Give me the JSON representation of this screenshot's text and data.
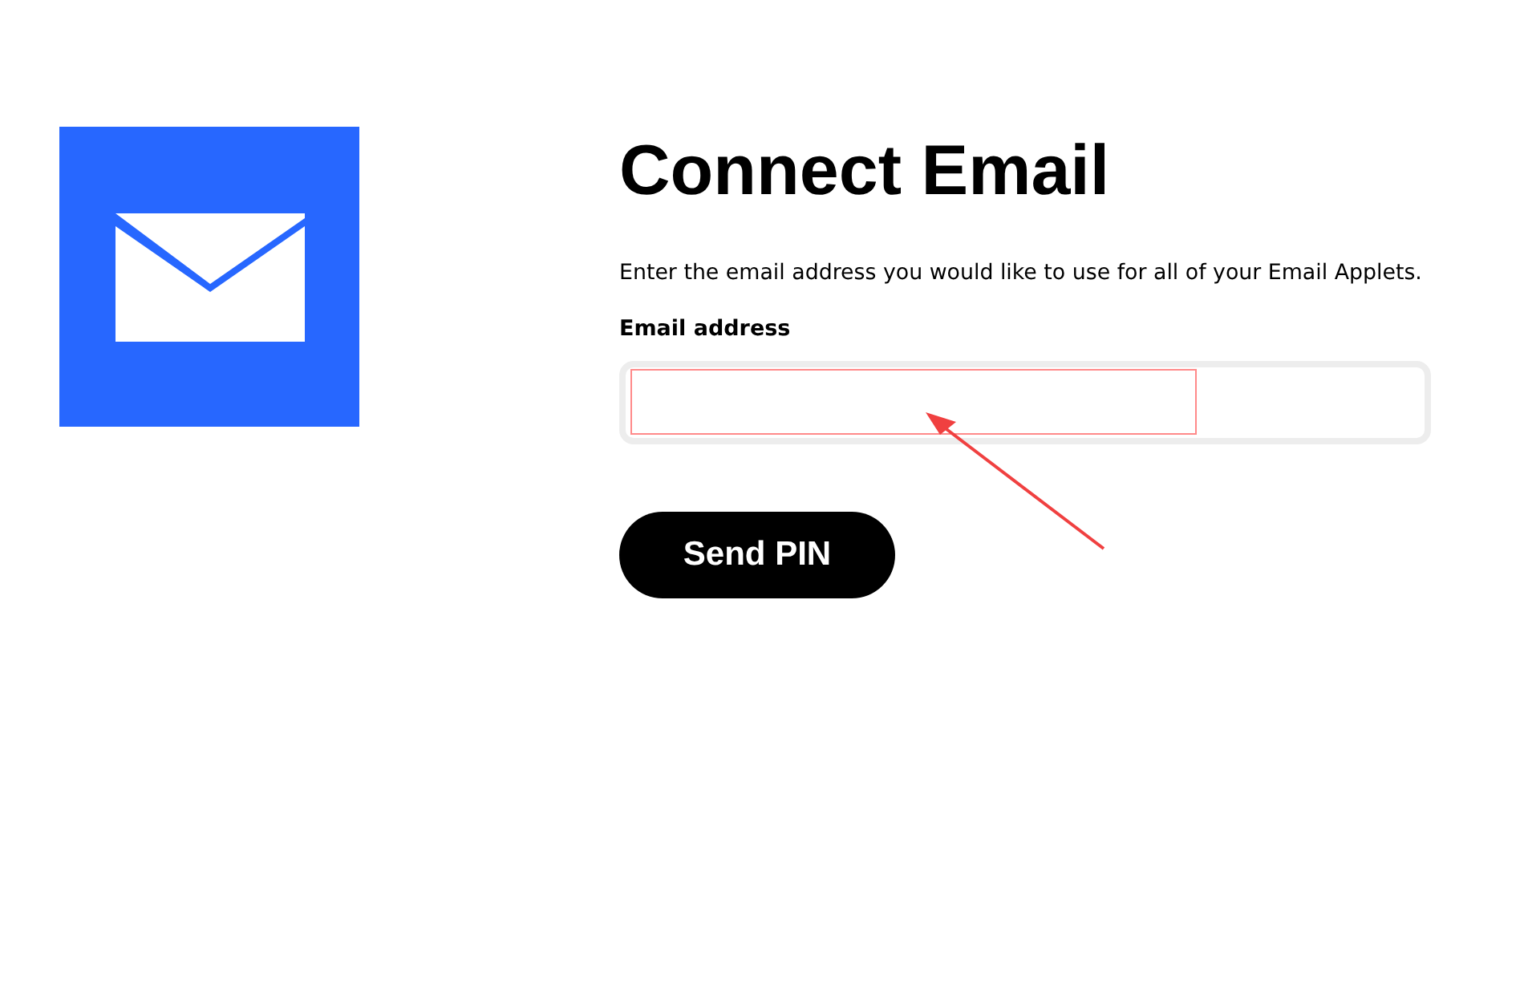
{
  "title": "Connect Email",
  "description": "Enter the email address you would like to use for all of your Email Applets.",
  "email_field": {
    "label": "Email address"
  },
  "button": "Send PIN"
}
